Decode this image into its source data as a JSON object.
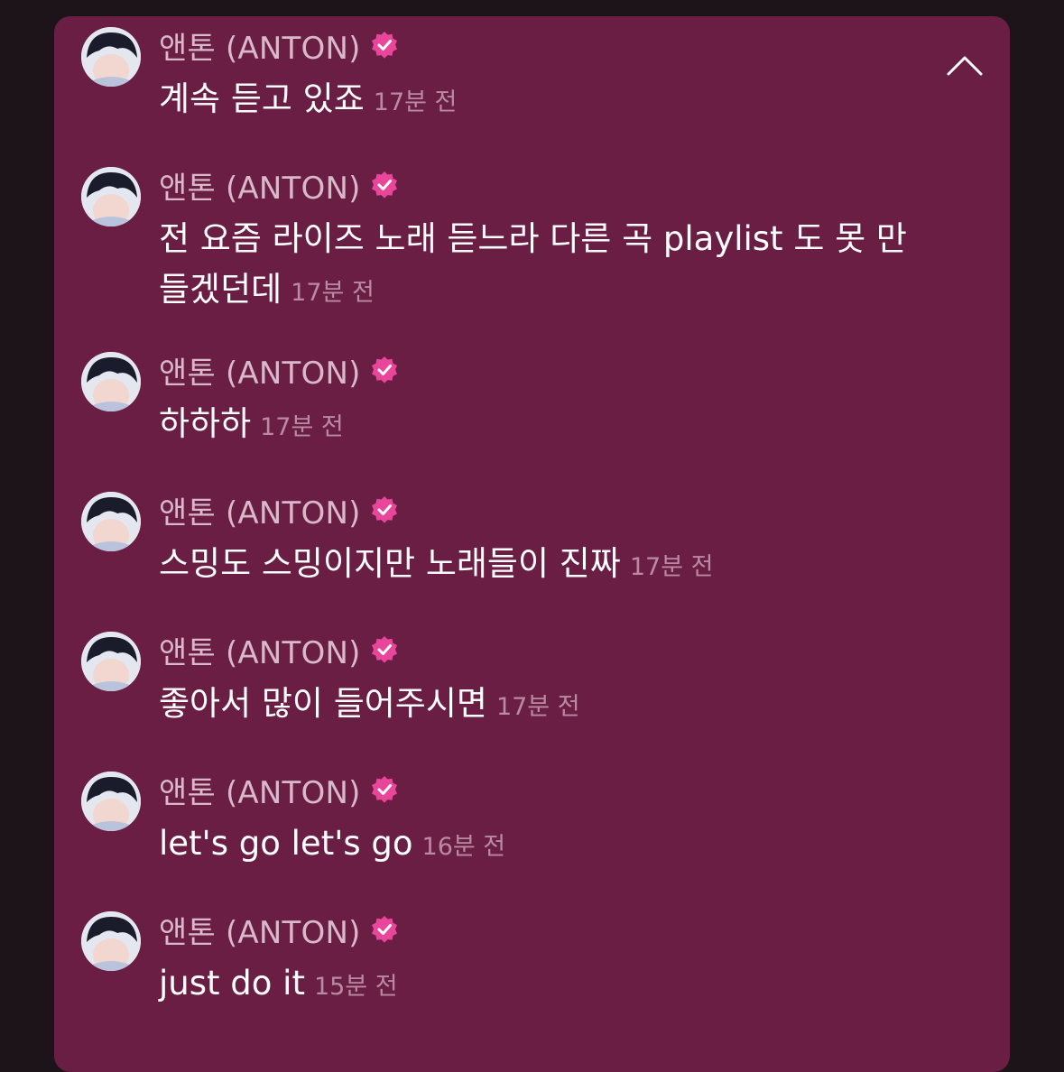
{
  "colors": {
    "panel_bg": "#6b1e44",
    "page_bg": "#1c1418",
    "name_text": "#d9b8c9",
    "message_text": "#ffffff",
    "time_text": "#b98aa2",
    "verified_badge": "#e8459b"
  },
  "header": {
    "collapse_icon": "chevron-up-icon"
  },
  "messages": [
    {
      "author": "앤톤 (ANTON)",
      "verified": true,
      "text": "계속 듣고 있죠",
      "time": "17분 전"
    },
    {
      "author": "앤톤 (ANTON)",
      "verified": true,
      "text": "전 요즘 라이즈 노래 듣느라 다른 곡 playlist 도 못 만들겠던데",
      "time": "17분 전"
    },
    {
      "author": "앤톤 (ANTON)",
      "verified": true,
      "text": "하하하",
      "time": "17분 전"
    },
    {
      "author": "앤톤 (ANTON)",
      "verified": true,
      "text": "스밍도 스밍이지만 노래들이 진짜",
      "time": "17분 전"
    },
    {
      "author": "앤톤 (ANTON)",
      "verified": true,
      "text": "좋아서 많이 들어주시면",
      "time": "17분 전"
    },
    {
      "author": "앤톤 (ANTON)",
      "verified": true,
      "text": "let's go let's go",
      "time": "16분 전"
    },
    {
      "author": "앤톤 (ANTON)",
      "verified": true,
      "text": "just do it",
      "time": "15분 전"
    }
  ]
}
